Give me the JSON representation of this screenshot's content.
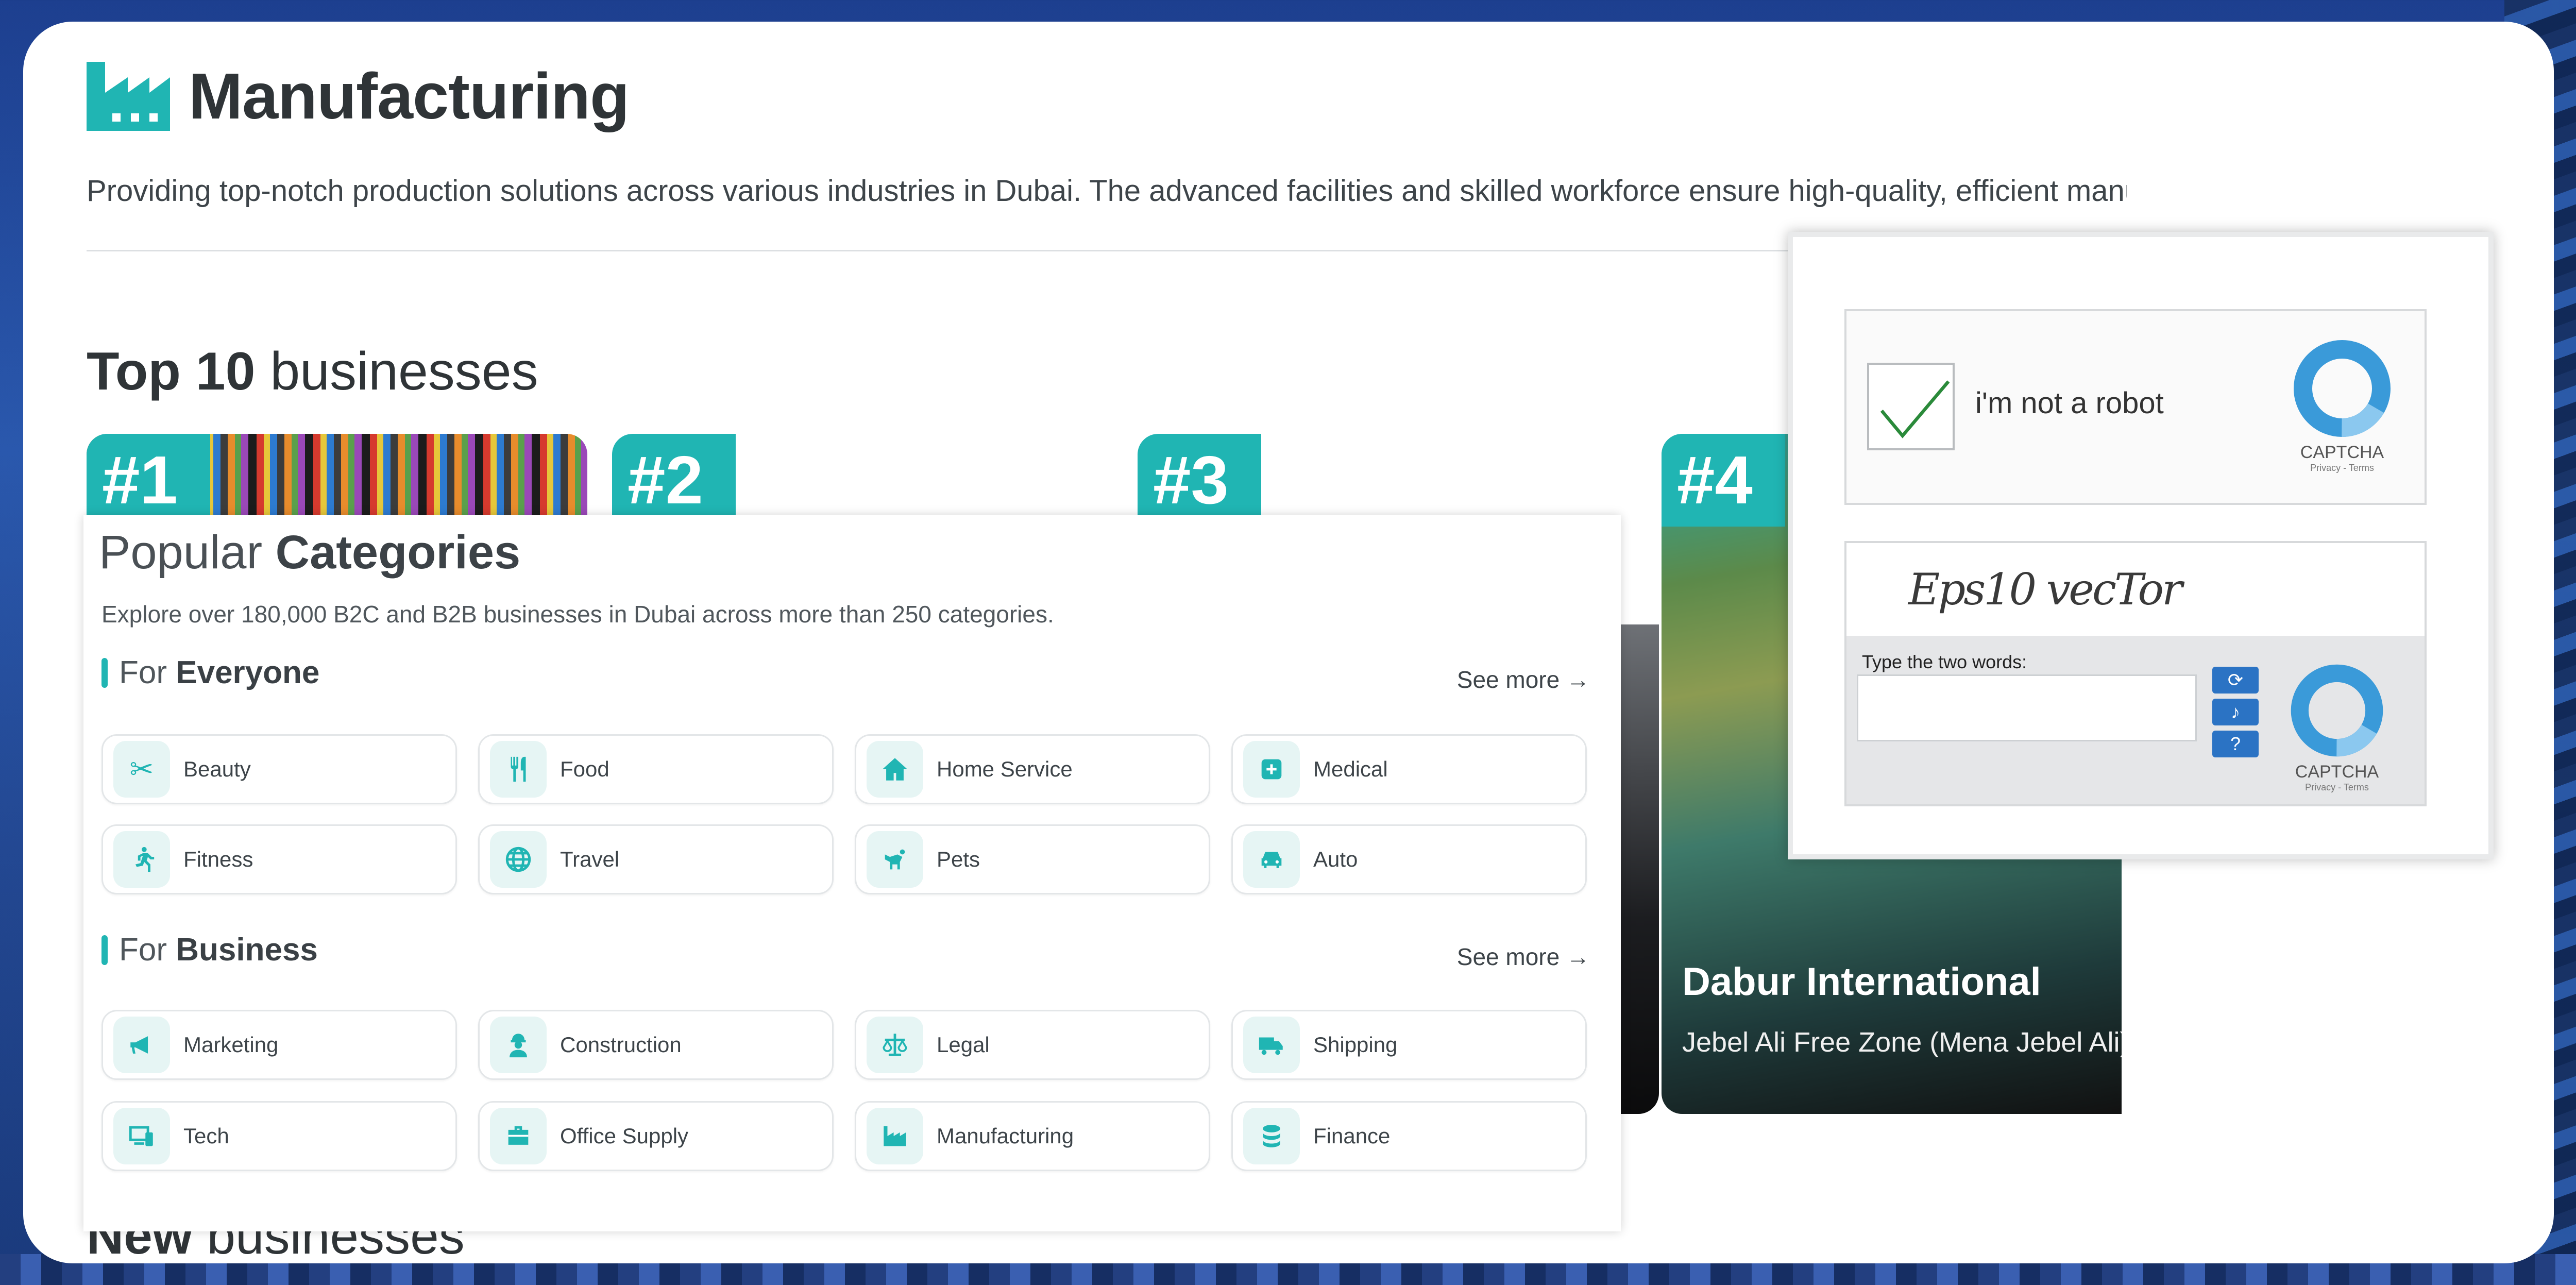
{
  "header": {
    "title": "Manufacturing",
    "description": "Providing top-notch production solutions across various industries in Dubai. The advanced facilities and skilled workforce ensure high-quality, efficient manufactu"
  },
  "top10": {
    "bold": "Top 10",
    "rest": " businesses",
    "ranks": [
      "#1",
      "#2",
      "#3",
      "#4"
    ],
    "featured": {
      "name": "Dabur International",
      "location": "Jebel Ali Free Zone (Mena Jebel Ali),"
    }
  },
  "new_businesses": {
    "bold": "New",
    "rest": " businesses"
  },
  "categories": {
    "title_light": "Popular ",
    "title_bold": "Categories",
    "subtitle": "Explore over 180,000 B2C and B2B businesses in Dubai across more than 250 categories.",
    "see_more": "See more",
    "everyone": {
      "prefix": "For ",
      "bold": "Everyone",
      "items": [
        {
          "label": "Beauty",
          "icon": "scissors-icon"
        },
        {
          "label": "Food",
          "icon": "utensils-icon"
        },
        {
          "label": "Home Service",
          "icon": "home-icon"
        },
        {
          "label": "Medical",
          "icon": "medical-icon"
        },
        {
          "label": "Fitness",
          "icon": "running-icon"
        },
        {
          "label": "Travel",
          "icon": "globe-icon"
        },
        {
          "label": "Pets",
          "icon": "pets-icon"
        },
        {
          "label": "Auto",
          "icon": "car-icon"
        }
      ]
    },
    "business": {
      "prefix": "For ",
      "bold": "Business",
      "items": [
        {
          "label": "Marketing",
          "icon": "megaphone-icon"
        },
        {
          "label": "Construction",
          "icon": "worker-icon"
        },
        {
          "label": "Legal",
          "icon": "scales-icon"
        },
        {
          "label": "Shipping",
          "icon": "truck-icon"
        },
        {
          "label": "Tech",
          "icon": "devices-icon"
        },
        {
          "label": "Office Supply",
          "icon": "briefcase-icon"
        },
        {
          "label": "Manufacturing",
          "icon": "factory-icon"
        },
        {
          "label": "Finance",
          "icon": "coins-icon"
        }
      ]
    }
  },
  "captcha": {
    "checkbox_label": "i'm not a robot",
    "brand": "CAPTCHA",
    "privacy_terms": "Privacy - Terms",
    "words_image_text": "Eps10 vecTor",
    "type_label": "Type the two words:",
    "input_value": "",
    "accent": "#2b73c4"
  },
  "colors": {
    "accent": "#20b5b3",
    "text": "#2f3437"
  }
}
